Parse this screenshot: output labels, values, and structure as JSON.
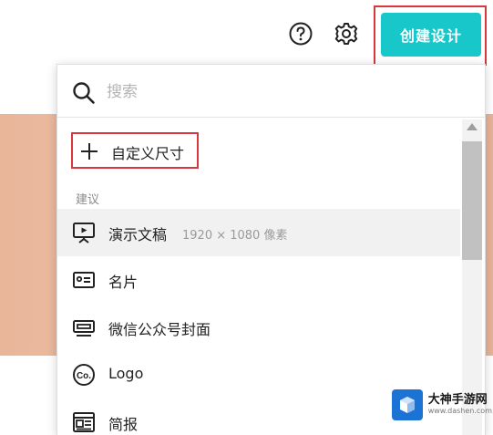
{
  "toolbar": {
    "help_icon": "help-circle-icon",
    "settings_icon": "gear-icon",
    "create_label": "创建设计",
    "accent_color": "#18c7c9",
    "highlight_color": "#d9363e"
  },
  "dropdown": {
    "search": {
      "placeholder": "搜索",
      "value": ""
    },
    "custom_size_label": "自定义尺寸",
    "section_title": "建议",
    "items": [
      {
        "icon": "presentation-icon",
        "label": "演示文稿",
        "detail": "1920 × 1080 像素"
      },
      {
        "icon": "business-card-icon",
        "label": "名片",
        "detail": ""
      },
      {
        "icon": "wechat-cover-icon",
        "label": "微信公众号封面",
        "detail": ""
      },
      {
        "icon": "logo-icon",
        "label": "Logo",
        "detail": ""
      },
      {
        "icon": "newsletter-icon",
        "label": "简报",
        "detail": ""
      }
    ]
  },
  "watermark": {
    "name": "大神手游网",
    "url": "www.dashen.com"
  }
}
